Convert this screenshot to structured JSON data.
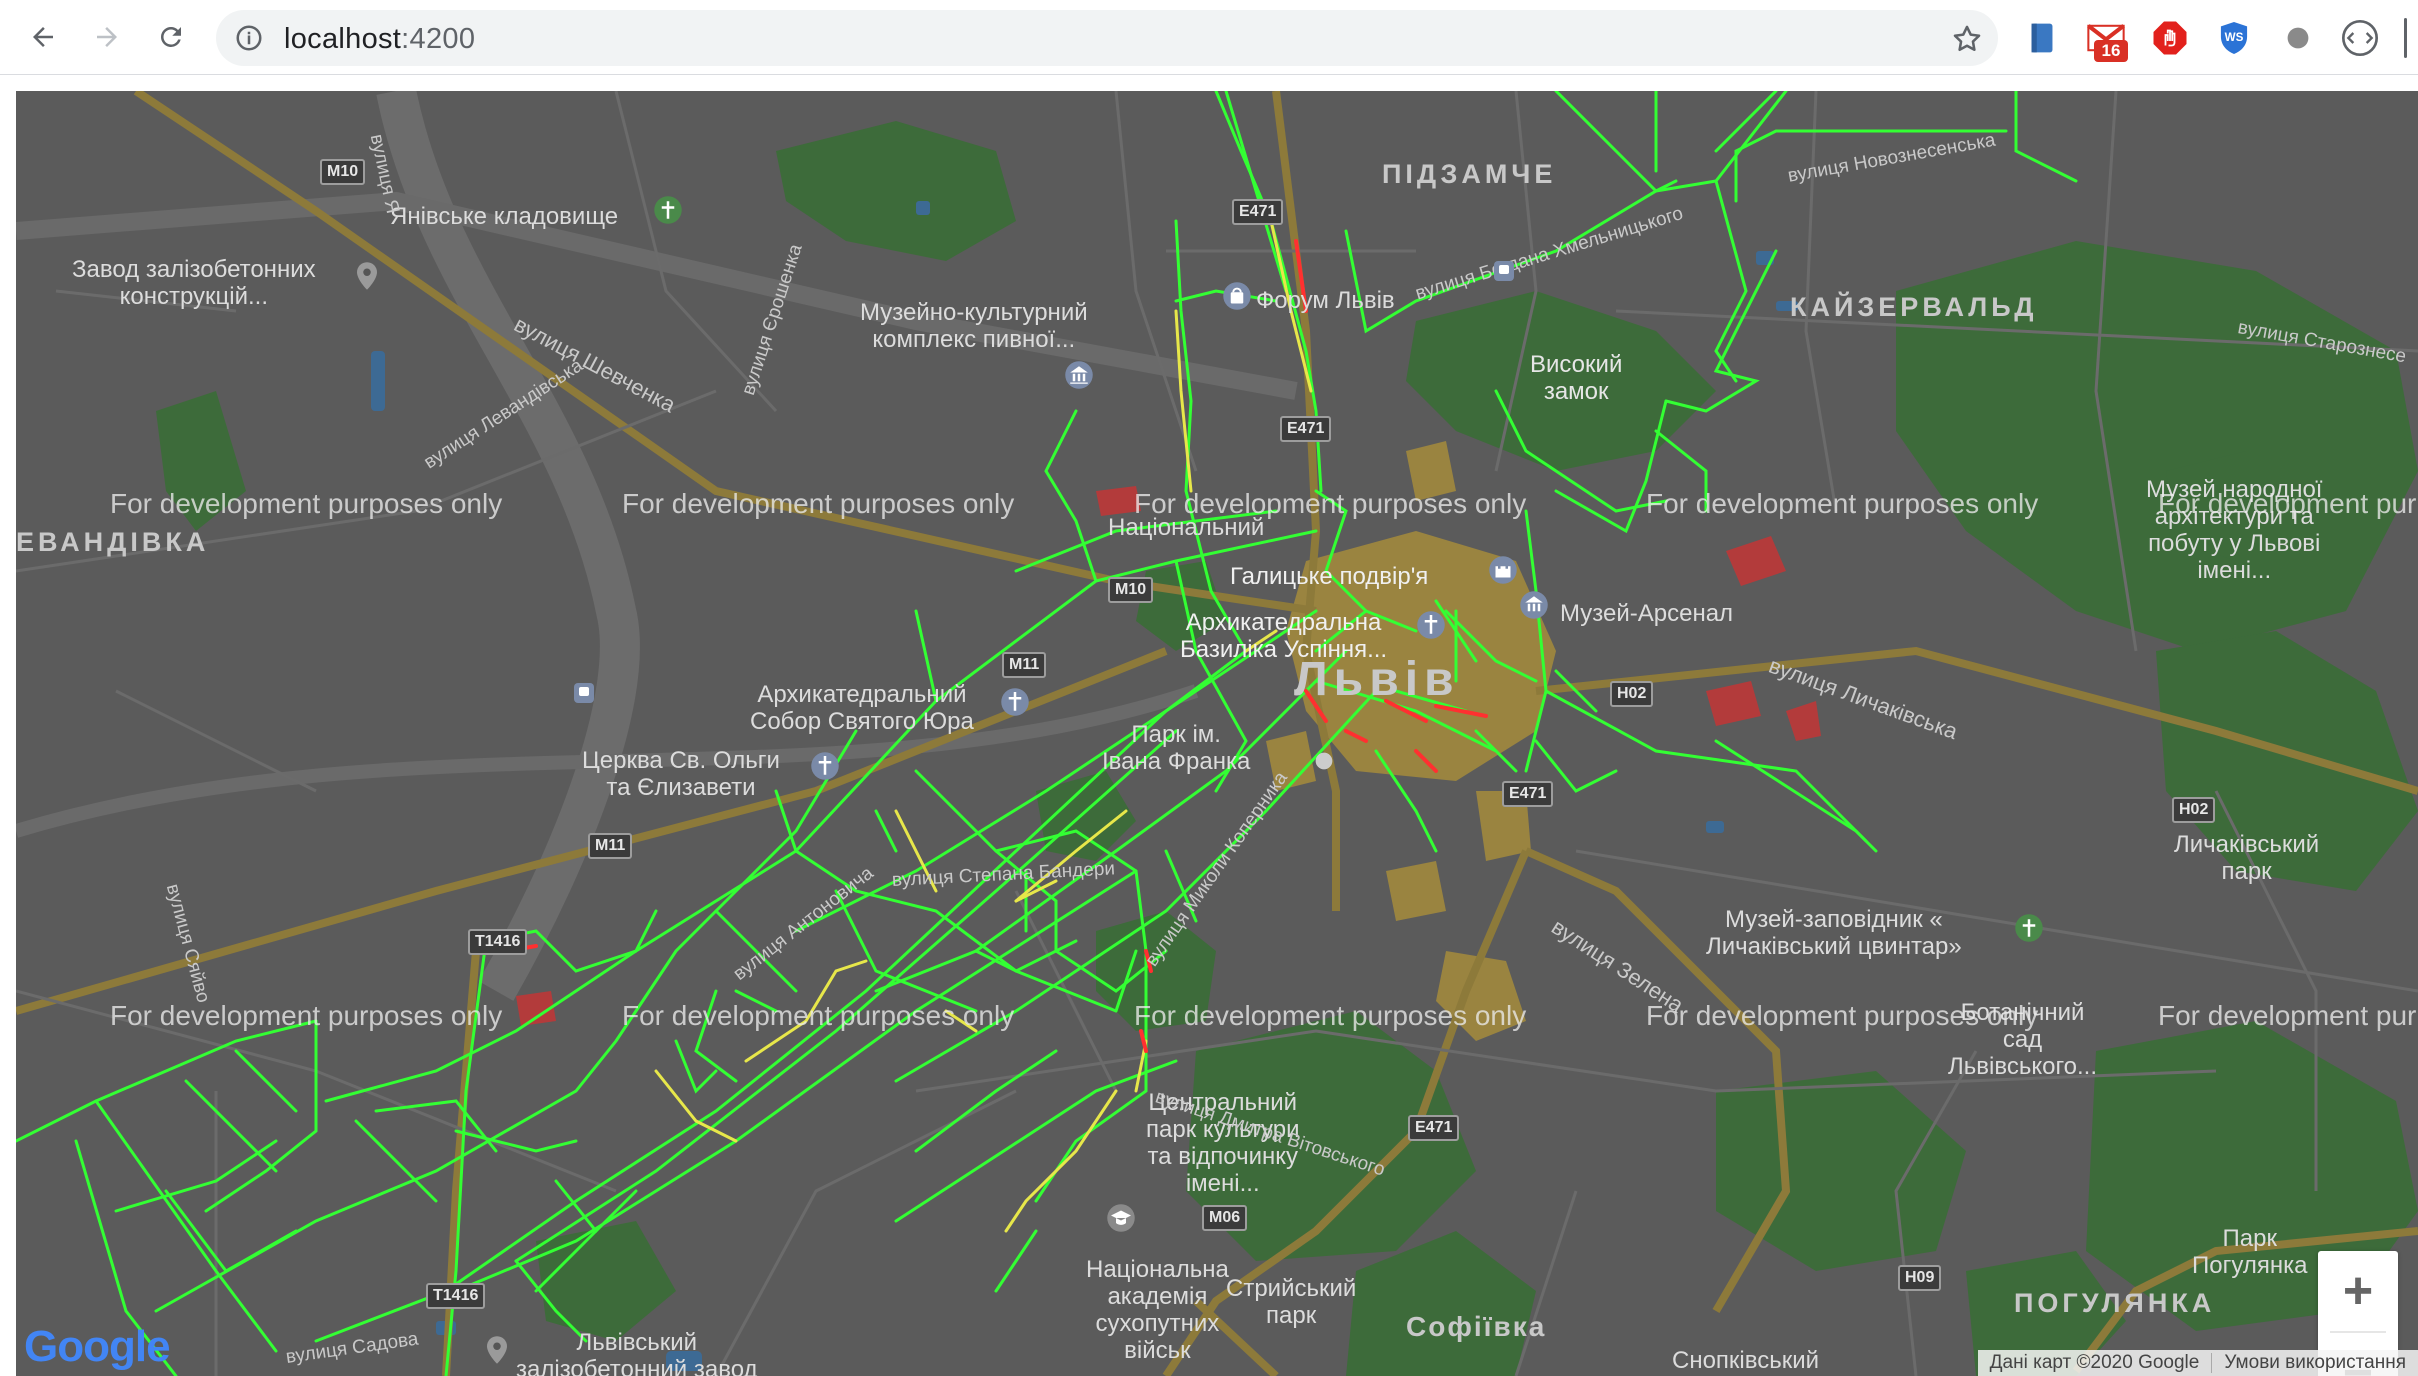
{
  "browser": {
    "url_host": "localhost",
    "url_port": ":4200",
    "gmail_badge": "16"
  },
  "map": {
    "watermark": "For development purposes only",
    "districts": {
      "pidzamche": "ПІДЗАМЧЕ",
      "kaizervald": "КАЙЗЕРВАЛЬД",
      "levandivka": "ЕВАНДІВКА",
      "pohulianka": "ПОГУЛЯНКА",
      "sofiivka": "Софіївка",
      "city": "Львів"
    },
    "places": {
      "yanivske": "Янівське кладовище",
      "zavod": "Завод залізобетонних\nконструкцій...",
      "muzeino": "Музейно-культурний\nкомплекс пивної...",
      "forum": "Форум Львів",
      "vysokyi": "Високий\nзамок",
      "natsionalnyi": "Національний",
      "halytske": "Галицьке подвір'я",
      "arsenal": "Музей-Арсенал",
      "bazylika": "Архикатедральна\nБазиліка Успіння...",
      "yura": "Архикатедральний\nСобор Святого Юра",
      "olhy": "Церква Св. Ольги\nта Єлизавети",
      "park_franka": "Парк ім.\nІвана Франка",
      "muzei_narodnoi": "Музей народної\nархітектури та\nпобуту у Львові\nімені...",
      "lychakivskyi_park": "Личаківський\nпарк",
      "lychakivskyi_tsvyntar": "Музей-заповідник «\nЛичаківський цвинтар»",
      "botanichnyi": "Ботанічний\nсад\nЛьвівського...",
      "tsentralnyi": "Центральний\nпарк культури\nта відпочинку\nімені...",
      "akademiia": "Національна\nакадемія\nсухопутних\nвійськ",
      "stryiskyi": "Стрийський\nпарк",
      "park_pohulianka": "Парк\nПогулянка",
      "lvivskyi_zavod": "Львівський\nзалізобетонний завод",
      "snopkivskyi": "Снопківський"
    },
    "streets": {
      "shevchenka": "вулиця Шевченка",
      "levandivska": "вулиця Левандівська",
      "yeroshenka": "вулиця Єрошенка",
      "khmelnytskoho": "вулиця Богдана Хмельницького",
      "novoznesenska": "вулиця Новознесенська",
      "starozneseska": "вулиця Старознесе",
      "lychakivska": "вулиця Личаківська",
      "zelena": "вулиця Зелена",
      "koperynka": "вулиця Миколи Коперника",
      "bandery": "вулиця Степана Бандери",
      "antonovycha": "вулиця Антоновича",
      "vitovskoho": "вулиця Дмитра Вітовського",
      "syaivo": "вулиця Сяйво",
      "sadova": "вулиця Садова",
      "yanivska": "вулиця Я"
    },
    "highways": {
      "m10": "M10",
      "e471_a": "E471",
      "e471_b": "E471",
      "m10_b": "M10",
      "m11": "M11",
      "m11_b": "M11",
      "t1416_a": "T1416",
      "t1416_b": "T1416",
      "h02_a": "H02",
      "h02_b": "H02",
      "e471_c": "E471",
      "e471_d": "E471",
      "m06": "M06",
      "h09": "H09"
    },
    "zoom_in": "+",
    "zoom_out": "−",
    "attribution": "Дані карт ©2020 Google",
    "terms": "Умови використання",
    "google_logo": "Google",
    "colors": {
      "traffic_free": "#33ff33",
      "traffic_slow": "#ffee33",
      "traffic_jam": "#ff3030",
      "park": "#3f7a3c",
      "water": "#3e6f9e",
      "landmark_area": "#a08a3c"
    }
  }
}
